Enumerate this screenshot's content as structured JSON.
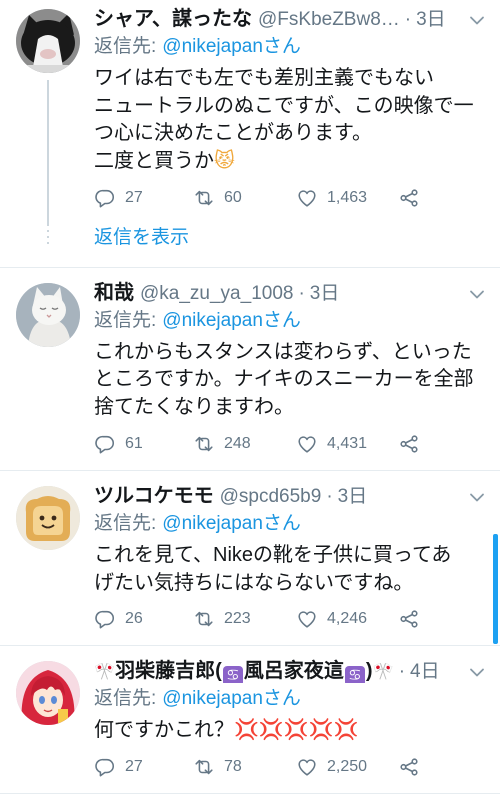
{
  "ui": {
    "separator": "·",
    "reply_prefix": "返信先:"
  },
  "colors": {
    "text": "#14171a",
    "secondary": "#657786",
    "link": "#1b95e0",
    "divider": "#e6ecf0",
    "scrollbar": "#1da1f2"
  },
  "icons": {
    "reply": "reply-icon",
    "retweet": "retweet-icon",
    "like": "heart-icon",
    "share": "share-icon",
    "menu": "chevron-down-icon"
  },
  "tweets": [
    {
      "avatar": "black-white-cat-avatar",
      "name": "シャア、謀ったな",
      "handle": "@FsKbeZBw8…",
      "time": "3日",
      "reply_to": "@nikejapanさん",
      "text_lines": [
        "ワイは右でも左でも差別主義でもない",
        "ニュートラルのぬこですが、この映像で一",
        "つ心に決めたことがあります。",
        "二度と買うか😾"
      ],
      "reply_count": "27",
      "retweet_count": "60",
      "like_count": "1,463",
      "show_replies": "返信を表示"
    },
    {
      "avatar": "white-cat-avatar",
      "name": "和哉",
      "handle": "@ka_zu_ya_1008",
      "time": "3日",
      "reply_to": "@nikejapanさん",
      "text_lines": [
        "これからもスタンスは変わらず、といった",
        "ところですか。ナイキのスニーカーを全部",
        "捨てたくなりますわ。"
      ],
      "reply_count": "61",
      "retweet_count": "248",
      "like_count": "4,431"
    },
    {
      "avatar": "bread-face-avatar",
      "name": "ツルコケモモ",
      "handle": "@spcd65b9",
      "time": "3日",
      "reply_to": "@nikejapanさん",
      "text_lines": [
        "これを見て、Nikeの靴を子供に買ってあ",
        "げたい気持ちにはならないですね。"
      ],
      "reply_count": "26",
      "retweet_count": "223",
      "like_count": "4,246"
    },
    {
      "avatar": "anime-girl-avatar",
      "name": "🎌羽柴藤吉郎(♋風呂家夜這♋)🎌",
      "time": "4日",
      "reply_to": "@nikejapanさん",
      "text_lines": [
        "何ですかこれ？💢💢💢💢💢"
      ],
      "reply_count": "27",
      "retweet_count": "78",
      "like_count": "2,250"
    }
  ]
}
